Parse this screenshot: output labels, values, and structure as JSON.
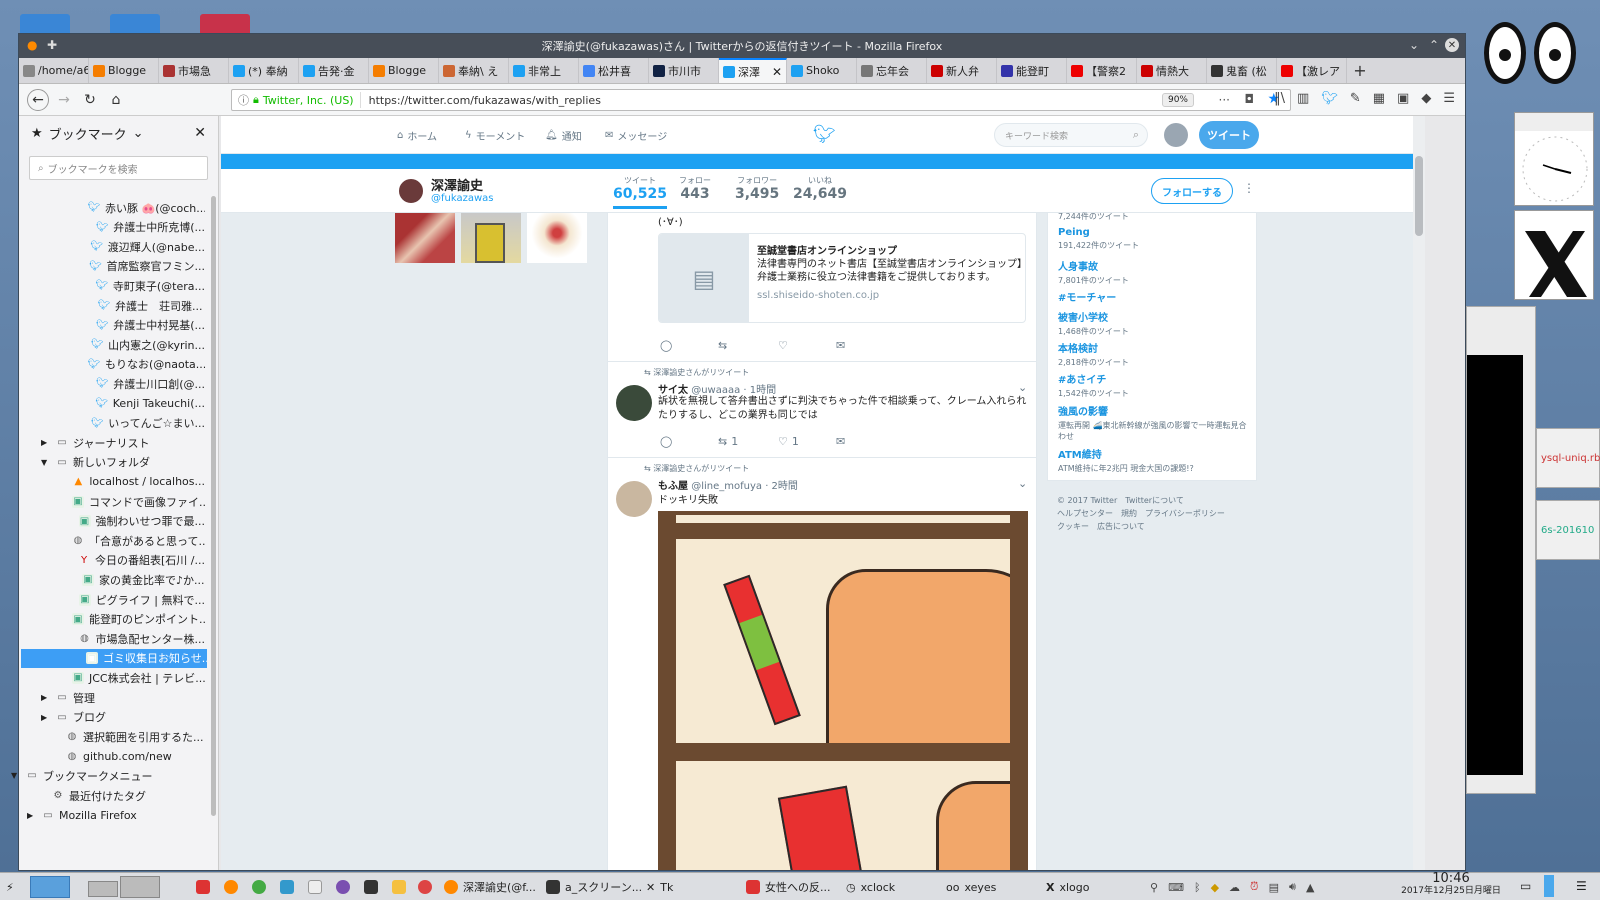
{
  "window": {
    "title": "深澤諭史(@fukazawas)さん | Twitterからの返信付きツイート - Mozilla Firefox"
  },
  "tabs": [
    {
      "label": "/home/a66",
      "color": "#888"
    },
    {
      "label": "Blogge",
      "color": "#f57d00"
    },
    {
      "label": "市場急",
      "color": "#a33"
    },
    {
      "label": "(*) 奉納",
      "color": "#1da1f2"
    },
    {
      "label": "告発·金",
      "color": "#1da1f2"
    },
    {
      "label": "Blogge",
      "color": "#f57d00"
    },
    {
      "label": "奉納\\ え",
      "color": "#c63"
    },
    {
      "label": "非常上",
      "color": "#1da1f2"
    },
    {
      "label": "松井喜",
      "color": "#4285f4"
    },
    {
      "label": "市川市",
      "color": "#124"
    },
    {
      "label": "深澤",
      "color": "#1da1f2",
      "active": true
    },
    {
      "label": "Shoko",
      "color": "#1da1f2"
    },
    {
      "label": "忘年会",
      "color": "#777"
    },
    {
      "label": "新人弁",
      "color": "#c00"
    },
    {
      "label": "能登町",
      "color": "#33a"
    },
    {
      "label": "【警察2",
      "color": "#e00"
    },
    {
      "label": "情熱大",
      "color": "#c00"
    },
    {
      "label": "鬼畜 (松",
      "color": "#333"
    },
    {
      "label": "【激レア",
      "color": "#e00"
    }
  ],
  "navbar": {
    "site_identity": "Twitter, Inc. (US)",
    "url": "https://twitter.com/fukazawas/with_replies",
    "zoom": "90%"
  },
  "sidebar": {
    "title": "ブックマーク",
    "search_placeholder": "ブックマークを検索",
    "items": [
      {
        "label": "赤い豚 🐽(@coch...",
        "indent": 78,
        "icon": "twitter-icon"
      },
      {
        "label": "弁護士中所克博(...",
        "indent": 78,
        "icon": "twitter-icon"
      },
      {
        "label": "渡辺輝人(@nabe...",
        "indent": 78,
        "icon": "twitter-icon"
      },
      {
        "label": "首席監察官フミン...",
        "indent": 78,
        "icon": "twitter-icon"
      },
      {
        "label": "寺町東子(@tera...",
        "indent": 78,
        "icon": "twitter-icon"
      },
      {
        "label": "弁護士　荘司雅...",
        "indent": 78,
        "icon": "twitter-icon"
      },
      {
        "label": "弁護士中村晃基(...",
        "indent": 78,
        "icon": "twitter-icon"
      },
      {
        "label": "山内憲之(@kyrin...",
        "indent": 78,
        "icon": "twitter-icon"
      },
      {
        "label": "もりなお(@naota...",
        "indent": 78,
        "icon": "twitter-icon"
      },
      {
        "label": "弁護士川口創(@...",
        "indent": 78,
        "icon": "twitter-icon"
      },
      {
        "label": "Kenji Takeuchi(...",
        "indent": 78,
        "icon": "twitter-icon"
      },
      {
        "label": "いってんご☆まい...",
        "indent": 78,
        "icon": "twitter-icon"
      },
      {
        "label": "ジャーナリスト",
        "indent": 36,
        "icon": "folder-icon",
        "twisty": "▶"
      },
      {
        "label": "新しいフォルダ",
        "indent": 36,
        "icon": "folder-icon",
        "twisty": "▼"
      },
      {
        "label": "localhost / localhos...",
        "indent": 62,
        "icon": "pma-icon"
      },
      {
        "label": "コマンドで画像ファイ...",
        "indent": 62,
        "icon": "page-icon"
      },
      {
        "label": "強制わいせつ罪で最...",
        "indent": 62,
        "icon": "page-icon"
      },
      {
        "label": "「合意があると思って...",
        "indent": 62,
        "icon": "globe-icon"
      },
      {
        "label": "今日の番組表[石川 /...",
        "indent": 62,
        "icon": "yahoo-icon"
      },
      {
        "label": "家の黄金比率で♪か...",
        "indent": 62,
        "icon": "page-icon"
      },
      {
        "label": "ピグライフ | 無料で...",
        "indent": 62,
        "icon": "page-icon"
      },
      {
        "label": "能登町のピンポイント...",
        "indent": 62,
        "icon": "page-icon"
      },
      {
        "label": "市場急配センター株...",
        "indent": 62,
        "icon": "globe-icon"
      },
      {
        "label": "ゴミ収集日お知らせ...",
        "indent": 62,
        "icon": "page-icon",
        "selected": true
      },
      {
        "label": "JCC株式会社 | テレビ...",
        "indent": 62,
        "icon": "page-icon"
      },
      {
        "label": "管理",
        "indent": 36,
        "icon": "folder-icon",
        "twisty": "▶"
      },
      {
        "label": "ブログ",
        "indent": 36,
        "icon": "folder-icon",
        "twisty": "▶"
      },
      {
        "label": "選択範囲を引用するた...",
        "indent": 46,
        "icon": "globe-icon"
      },
      {
        "label": "github.com/new",
        "indent": 46,
        "icon": "globe-icon"
      },
      {
        "label": "ブックマークメニュー",
        "indent": 6,
        "icon": "folder-icon",
        "twisty": "▼"
      },
      {
        "label": "最近付けたタグ",
        "indent": 32,
        "icon": "gear-icon"
      },
      {
        "label": "Mozilla Firefox",
        "indent": 22,
        "icon": "folder-icon",
        "twisty": "▶"
      }
    ]
  },
  "twitter": {
    "nav": {
      "home": "ホーム",
      "moments": "モーメント",
      "notifications": "通知",
      "messages": "メッセージ"
    },
    "search_placeholder": "キーワード検索",
    "tweet_button": "ツイート",
    "profile": {
      "name": "深澤諭史",
      "handle": "@fukazawas",
      "stats": [
        {
          "label": "ツイート",
          "value": "60,525"
        },
        {
          "label": "フォロー",
          "value": "443"
        },
        {
          "label": "フォロワー",
          "value": "3,495"
        },
        {
          "label": "いいね",
          "value": "24,649"
        }
      ],
      "follow_button": "フォローする"
    },
    "timeline": {
      "prev_fragment": "(･∀･)",
      "card": {
        "title": "至誠堂書店オンラインショップ",
        "description": "法律書専門のネット書店【至誠堂書店オンラインショップ】弁護士業務に役立つ法律書籍をご提供しております。",
        "domain": "ssl.shiseido-shoten.co.jp"
      },
      "tweets": [
        {
          "retweet_note": "深澤諭史さんがリツイート",
          "name": "サイ太",
          "handle": "@uwaaaa",
          "time": "· 1時間",
          "text": "訴状を無視して答弁書出さずに判決でちゃった件で相談乗って、クレーム入れられたりするし、どこの業界も同じでは",
          "retweets": "1",
          "likes": "1"
        },
        {
          "retweet_note": "深澤諭史さんがリツイート",
          "name": "もふ屋",
          "handle": "@line_mofuya",
          "time": "· 2時間",
          "text": "ドッキリ失敗"
        }
      ]
    },
    "trends": [
      {
        "name": "",
        "count": "7,244件のツイート"
      },
      {
        "name": "Peing",
        "count": "191,422件のツイート"
      },
      {
        "name": "人身事故",
        "count": "7,801件のツイート"
      },
      {
        "name": "#モーチャー",
        "count": ""
      },
      {
        "name": "被害小学校",
        "count": "1,468件のツイート"
      },
      {
        "name": "本格検討",
        "count": "2,818件のツイート"
      },
      {
        "name": "#あさイチ",
        "count": "1,542件のツイート"
      },
      {
        "name": "強風の影響",
        "count": "運転再開 🚄東北新幹線が強風の影響で一時運転見合わせ"
      },
      {
        "name": "ATM維持",
        "count": "ATM維持に年2兆円 現金大国の課題!?"
      }
    ],
    "footer": {
      "line1": "© 2017 Twitter　Twitterについて",
      "line2": "ヘルプセンター　規約　プライバシーポリシー",
      "line3": "クッキー　広告について"
    }
  },
  "taskbar": {
    "tasks": [
      "深澤諭史(@f...",
      "a_スクリーン...",
      "Tk",
      "女性への反...",
      "xclock",
      "xeyes",
      "xlogo"
    ],
    "time": "10:46",
    "date": "2017年12月25日月曜日"
  },
  "side_windows": {
    "terminal_snippet_1": "ysql-uniq.rb",
    "terminal_snippet_2": "6s-201610"
  }
}
